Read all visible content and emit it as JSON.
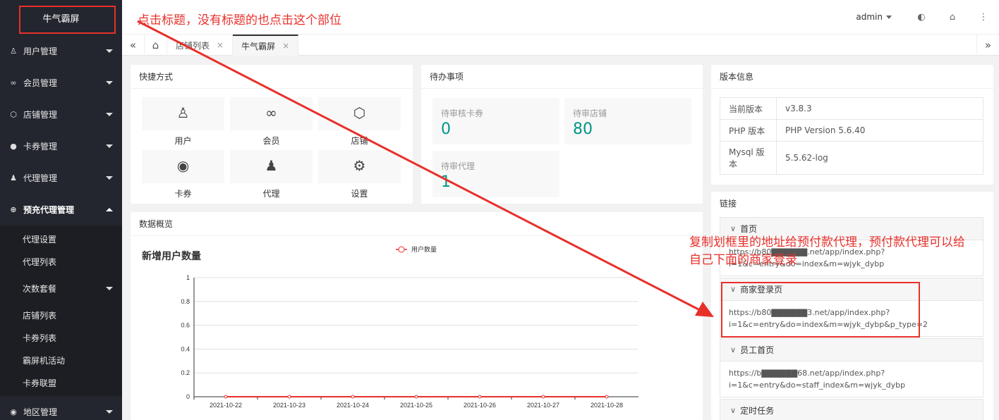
{
  "brand": "牛气霸屏",
  "sidebar": {
    "items": [
      {
        "label": "用户管理",
        "icon": "user-icon",
        "glyph": "♙"
      },
      {
        "label": "会员管理",
        "icon": "infinity-icon",
        "glyph": "∞"
      },
      {
        "label": "店铺管理",
        "icon": "cube-icon",
        "glyph": "⬡"
      },
      {
        "label": "卡券管理",
        "icon": "circle-icon",
        "glyph": "●"
      },
      {
        "label": "代理管理",
        "icon": "person-icon",
        "glyph": "♟"
      },
      {
        "label": "预充代理管理",
        "icon": "plus-circle-icon",
        "glyph": "⊕"
      }
    ],
    "submenu": [
      "代理设置",
      "代理列表",
      "次数套餐",
      "店铺列表",
      "卡券列表",
      "霸屏机活动",
      "卡券联盟"
    ],
    "bottom_item": {
      "label": "地区管理",
      "icon": "compass-icon",
      "glyph": "◉"
    }
  },
  "header": {
    "user": "admin"
  },
  "tabs": [
    "店铺列表",
    "牛气霸屏"
  ],
  "shortcuts": {
    "title": "快捷方式",
    "items": [
      {
        "label": "用户",
        "icon": "user-icon",
        "glyph": "♙"
      },
      {
        "label": "会员",
        "icon": "infinity-icon",
        "glyph": "∞"
      },
      {
        "label": "店铺",
        "icon": "cube-icon",
        "glyph": "⬡"
      },
      {
        "label": "卡券",
        "icon": "circle-icon",
        "glyph": "◉"
      },
      {
        "label": "代理",
        "icon": "person-icon",
        "glyph": "♟"
      },
      {
        "label": "设置",
        "icon": "gear-icon",
        "glyph": "⚙"
      }
    ]
  },
  "todo": {
    "title": "待办事项",
    "items": [
      {
        "label": "待审核卡券",
        "value": "0"
      },
      {
        "label": "待审店铺",
        "value": "80"
      },
      {
        "label": "待审代理",
        "value": "1"
      }
    ]
  },
  "version": {
    "title": "版本信息",
    "rows": [
      {
        "key": "当前版本",
        "value": "v3.8.3"
      },
      {
        "key": "PHP 版本",
        "value": "PHP Version 5.6.40"
      },
      {
        "key": "Mysql 版本",
        "value": "5.5.62-log"
      }
    ]
  },
  "links": {
    "title": "链接",
    "items": [
      {
        "title": "首页",
        "body": "https://b80▇▇▇▇▇▇.net/app/index.php?i=1&c=entry&do=index&m=wjyk_dybp"
      },
      {
        "title": "商家登录页",
        "body": "https://b80▇▇▇▇▇▇3.net/app/index.php?i=1&c=entry&do=index&m=wjyk_dybp&p_type=2"
      },
      {
        "title": "员工首页",
        "body": "https://b▇▇▇▇▇▇68.net/app/index.php?i=1&c=entry&do=staff_index&m=wjyk_dybp"
      },
      {
        "title": "定时任务",
        "body": ""
      }
    ]
  },
  "overview": {
    "title": "数据概览"
  },
  "chart_data": {
    "type": "line",
    "title": "新增用户数量",
    "categories": [
      "2021-10-22",
      "2021-10-23",
      "2021-10-24",
      "2021-10-25",
      "2021-10-26",
      "2021-10-27",
      "2021-10-28"
    ],
    "series": [
      {
        "name": "用户数量",
        "values": [
          0,
          0,
          0,
          0,
          0,
          0,
          0
        ],
        "color": "#e8302b"
      }
    ],
    "yticks": [
      "0",
      "0.2",
      "0.4",
      "0.6",
      "0.8",
      "1"
    ],
    "ylim": [
      0,
      1
    ],
    "legend": "top-center",
    "grid": true
  },
  "annotations": {
    "top": "点击标题，没有标题的也点击这个部位",
    "right": "复制划框里的地址给预付款代理，预付款代理可以给自己下面的商家登录"
  },
  "colors": {
    "sidebar": "#23262e",
    "accent": "#009688",
    "annotation": "#e8302b"
  }
}
